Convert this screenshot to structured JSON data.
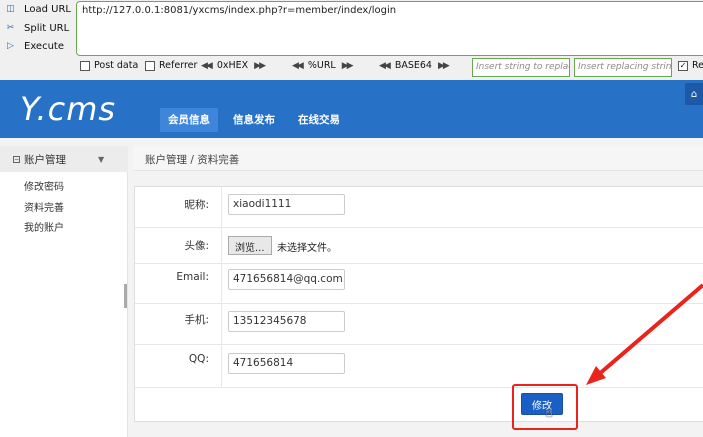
{
  "hackbar": {
    "actions": [
      "Load URL",
      "Split URL",
      "Execute"
    ],
    "url": "http://127.0.0.1:8081/yxcms/index.php?r=member/index/login",
    "options": {
      "post_data": "Post data",
      "referrer": "Referrer",
      "hex": "0xHEX",
      "url": "%URL",
      "base64": "BASE64",
      "replace_placeholder": "Insert string to replace",
      "replacing_placeholder": "Insert replacing string",
      "re_label": "Re"
    }
  },
  "site": {
    "logo": "Y.cms",
    "nav": [
      "会员信息",
      "信息发布",
      "在线交易"
    ]
  },
  "sidebar": {
    "title": "账户管理",
    "links": [
      "修改密码",
      "资料完善",
      "我的账户"
    ]
  },
  "breadcrumb": "账户管理 / 资料完善",
  "form": {
    "nickname_label": "昵称:",
    "nickname_value": "xiaodi1111",
    "avatar_label": "头像:",
    "browse_label": "浏览...",
    "no_file_text": "未选择文件。",
    "email_label": "Email:",
    "email_value": "471656814@qq.com",
    "phone_label": "手机:",
    "phone_value": "13512345678",
    "qq_label": "QQ:",
    "qq_value": "471656814",
    "submit_label": "修改"
  },
  "colors": {
    "nav_bg": "#2771c7",
    "submit_bg": "#1a5fc4",
    "annotation_red": "#e8241c",
    "hackbar_border": "#6aa84f"
  }
}
